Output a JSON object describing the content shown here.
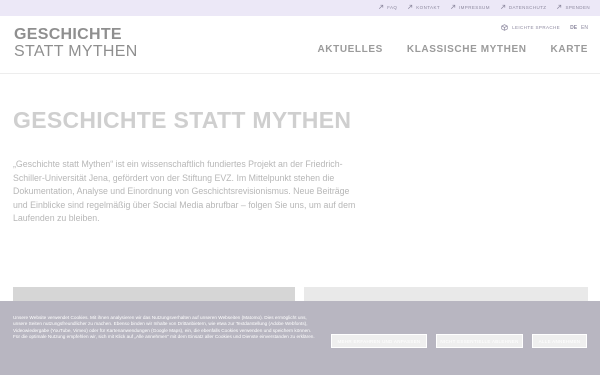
{
  "topbar": {
    "links": [
      {
        "label": "FAQ",
        "icon": "arrow-link-icon"
      },
      {
        "label": "KONTAKT",
        "icon": "arrow-link-icon"
      },
      {
        "label": "IMPRESSUM",
        "icon": "arrow-link-icon"
      },
      {
        "label": "DATENSCHUTZ",
        "icon": "arrow-link-icon"
      },
      {
        "label": "SPENDEN",
        "icon": "arrow-link-icon"
      }
    ]
  },
  "header": {
    "logo_line1": "GESCHICHTE",
    "logo_line2": "STATT MYTHEN",
    "easy_language": "LEICHTE SPRACHE",
    "languages": [
      "DE",
      "EN"
    ],
    "nav": [
      "AKTUELLES",
      "KLASSISCHE MYTHEN",
      "KARTE"
    ]
  },
  "main": {
    "title": "GESCHICHTE STATT MYTHEN",
    "intro": "„Geschichte statt Mythen“ ist ein wissenschaftlich fundiertes Projekt an der Friedrich-Schiller-Universität Jena, gefördert von der Stiftung EVZ. Im Mittelpunkt stehen die Dokumentation, Analyse und Einordnung von Geschichtsrevisionismus. Neue Beiträge und Einblicke sind regelmäßig über Social Media abrufbar – folgen Sie uns, um auf dem Laufenden zu bleiben."
  },
  "cookie": {
    "text": "Unsere Website verwendet Cookies. Mit ihnen analysieren wir das Nutzungsverhalten auf unseren Webseiten (Matomo). Dies ermöglicht uns, unsere Seiten nutzungsfreundlicher zu machen. Ebenso binden wir Inhalte von Drittanbietern, wie etwa zur Textdarstellung (Adobe Webfonts), Videowiedergabe (YouTube, Vimeo) oder für Kartenanwendungen (Google Maps), ein, die ebenfalls Cookies verwenden und speichern können. Für die optimale Nutzung empfehlen wir, sich mit Klick auf „Alle annehmen“ mit dem Einsatz aller Cookies und Dienste einverstanden zu erklären.",
    "buttons": [
      "MEHR ERFAHREN UND ANPASSEN",
      "NICHT ESSENTIELLE ABLEHNEN",
      "ALLE ANNEHMEN"
    ]
  },
  "colors": {
    "topbar_bg": "#ece8f7",
    "cookie_bg": "#b8b6c1",
    "accent": "#8e8aa0"
  }
}
